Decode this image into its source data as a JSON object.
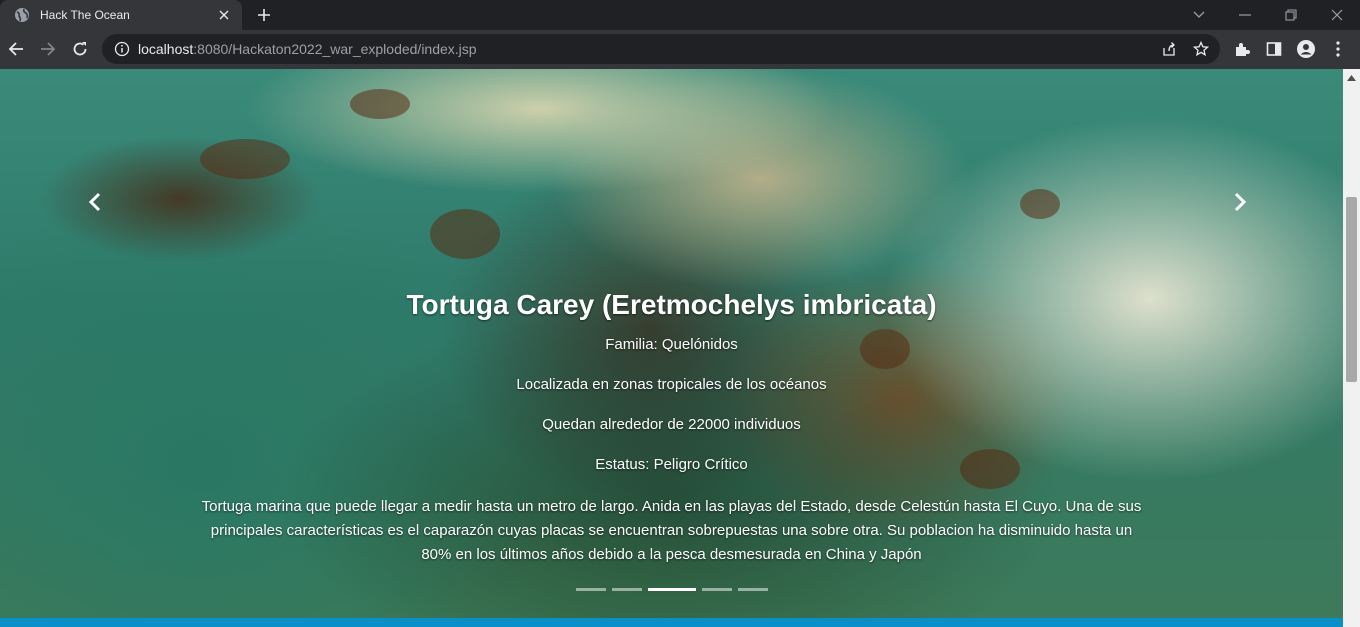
{
  "browser": {
    "tab_title": "Hack The Ocean",
    "url_host": "localhost",
    "url_rest": ":8080/Hackaton2022_war_exploded/index.jsp"
  },
  "carousel": {
    "title": "Tortuga Carey (Eretmochelys imbricata)",
    "family": "Familia: Quelónidos",
    "location": "Localizada en zonas tropicales de los océanos",
    "population": "Quedan alrededor de 22000 individuos",
    "status": "Estatus: Peligro Crítico",
    "description": "Tortuga marina que puede llegar a medir hasta un metro de largo. Anida en las playas del Estado, desde Celestún hasta El Cuyo. Una de sus principales características es el caparazón cuyas placas se encuentran sobrepuestas una sobre otra. Su poblacion ha disminuido hasta un 80% en los últimos años debido a la pesca desmesurada en China y Japón",
    "indicators_total": 5,
    "active_indicator": 3
  },
  "colors": {
    "accent_bar": "#0a8fc9"
  }
}
